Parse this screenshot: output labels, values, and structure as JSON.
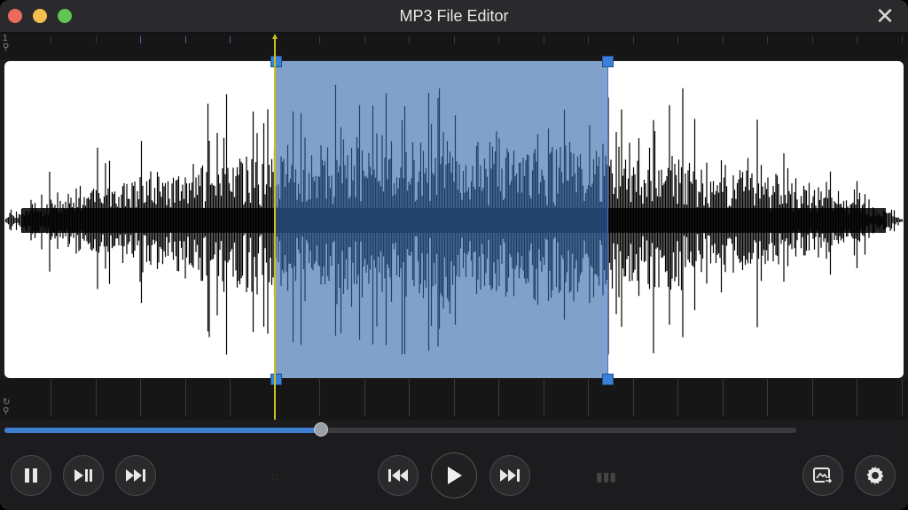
{
  "window": {
    "title": "MP3 File Editor"
  },
  "playback": {
    "progress_fraction": 0.4
  },
  "selection": {
    "start_fraction": 0.3,
    "end_fraction": 0.675
  },
  "controls": {
    "left": [
      {
        "name": "pause-button",
        "icon": "pause-icon"
      },
      {
        "name": "play-pause-button",
        "icon": "play-pause-icon"
      },
      {
        "name": "fast-forward-button",
        "icon": "fast-forward-icon"
      }
    ],
    "center": [
      {
        "name": "rewind-button",
        "icon": "rewind-icon"
      },
      {
        "name": "play-button",
        "icon": "play-icon"
      },
      {
        "name": "forward-button",
        "icon": "fast-forward-icon"
      }
    ],
    "right": [
      {
        "name": "export-button",
        "icon": "export-image-icon"
      },
      {
        "name": "settings-button",
        "icon": "gear-icon"
      }
    ]
  },
  "colors": {
    "accent": "#3f7fd0",
    "selection": "#3468aa",
    "playhead": "#c8c01a",
    "waveform": "#000000"
  }
}
